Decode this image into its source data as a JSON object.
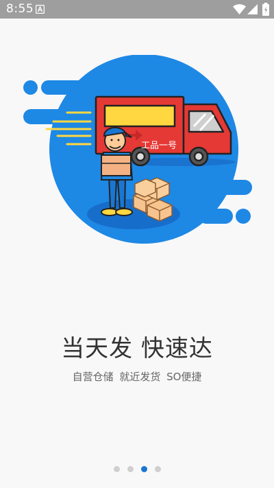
{
  "status_bar": {
    "time": "8:55",
    "icons": [
      "a-notification-icon",
      "wifi-icon",
      "signal-icon",
      "battery-icon"
    ]
  },
  "illustration": {
    "truck_text": "工品一号",
    "colors": {
      "circle": "#1e88e5",
      "truck": "#e53935",
      "stripe": "#ffd740"
    }
  },
  "headline": "当天发 快速达",
  "subline": "自营仓储  就近发货  SO便捷",
  "pager": {
    "count": 4,
    "active_index": 2
  },
  "colors": {
    "status_bar": "#9e9e9e",
    "accent": "#1976d2",
    "background": "#f8f8f8"
  }
}
